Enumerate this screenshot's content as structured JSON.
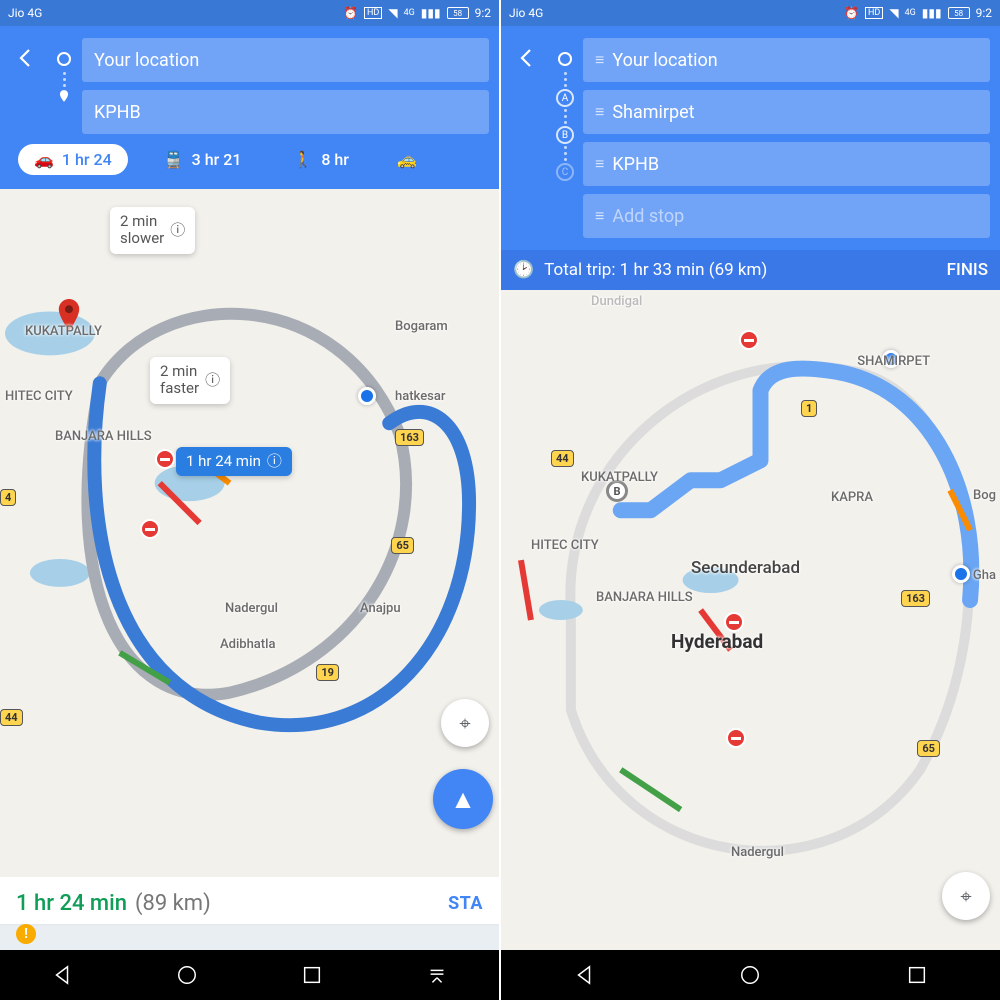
{
  "shared": {
    "status": {
      "carrier": "Jio 4G",
      "network": "4G",
      "battery": "58",
      "clock": "9:2",
      "alarm_icon": "alarm",
      "hd_icon": "HD"
    },
    "nav": {
      "back": "back",
      "home": "home",
      "recent": "recent",
      "extra": "collapse"
    }
  },
  "left": {
    "inputs": {
      "origin": "Your location",
      "destination": "KPHB"
    },
    "modes": {
      "car": "1 hr 24",
      "transit": "3 hr 21",
      "walk": "8 hr"
    },
    "route_badges": {
      "slower": "2 min\nslower",
      "faster": "2 min\nfaster",
      "primary": "1 hr 24 min"
    },
    "map_labels": {
      "kukatpally": "KUKATPALLY",
      "hitec": "HITEC CITY",
      "banjara": "BANJARA HILLS",
      "bogaram": "Bogaram",
      "ghatkesar": "hatkesar",
      "nadergul": "Nadergul",
      "anajpur": "Anajpu",
      "adibhatla": "Adibhatla"
    },
    "shields": {
      "s163": "163",
      "s65": "65",
      "s19": "19",
      "s4": "4",
      "s44": "44"
    },
    "bottom": {
      "time": "1 hr 24 min",
      "distance": "(89 km)",
      "start": "STA"
    }
  },
  "right": {
    "inputs": {
      "origin": "Your location",
      "stopA": "Shamirpet",
      "stopB": "KPHB",
      "addStop": "Add stop",
      "letterA": "A",
      "letterB": "B",
      "letterC": "C"
    },
    "banner": {
      "label": "Total trip: 1 hr 33 min  (69 km)",
      "finish": "FINIS"
    },
    "map_labels": {
      "dundigal": "Dundigal",
      "shamirpet": "SHAMIRPET",
      "kukatpally": "KUKATPALLY",
      "kapra": "KAPRA",
      "hitec": "HITEC CITY",
      "secunderabad": "Secunderabad",
      "banjara": "BANJARA HILLS",
      "hyderabad": "Hyderabad",
      "ghatkesar": "Gha",
      "bog": "Bog",
      "nadergul": "Nadergul"
    },
    "shields": {
      "s1": "1",
      "s44": "44",
      "s163": "163",
      "s65": "65"
    },
    "waypoint": {
      "b": "B"
    }
  }
}
